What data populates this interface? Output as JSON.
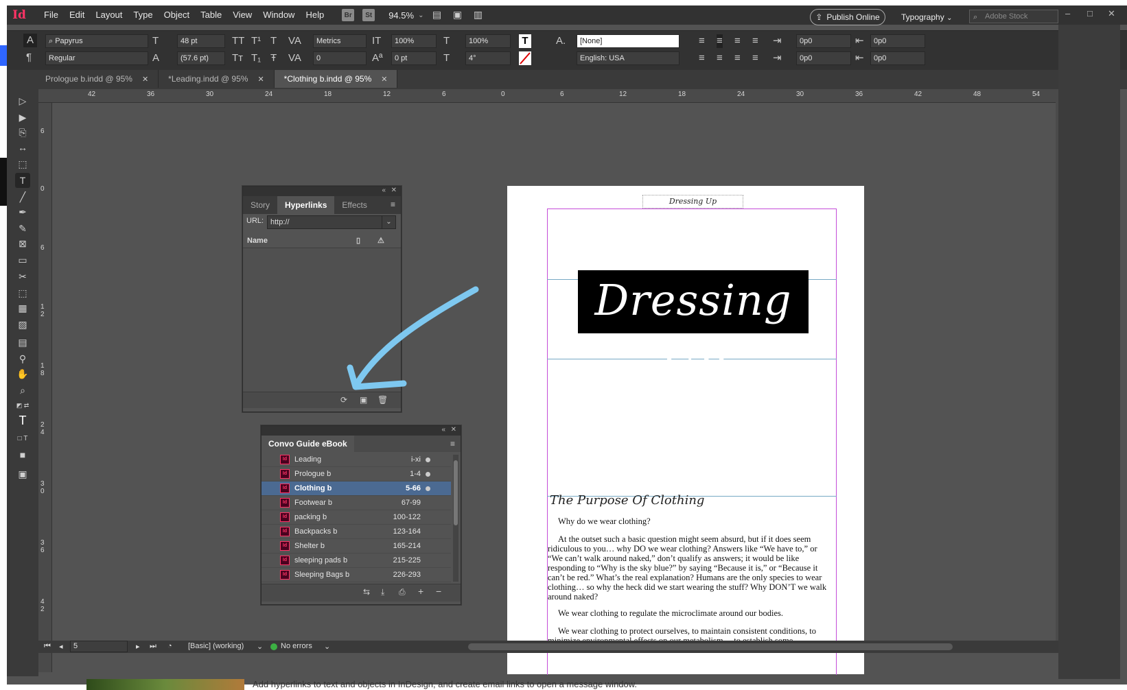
{
  "app": {
    "logo": "Id"
  },
  "menubar": {
    "items": [
      "File",
      "Edit",
      "Layout",
      "Type",
      "Object",
      "Table",
      "View",
      "Window",
      "Help"
    ],
    "bridge": "Br",
    "stock_badge": "St",
    "zoom": "94.5%",
    "publish_label": "Publish Online",
    "workspace": "Typography",
    "stock_placeholder": "Adobe Stock"
  },
  "control": {
    "font_family": "Papyrus",
    "font_style": "Regular",
    "font_size": "48 pt",
    "leading": "(57.6 pt)",
    "kerning": "Metrics",
    "tracking": "0",
    "vertical_scale": "100%",
    "horizontal_scale": "100%",
    "baseline_shift": "0 pt",
    "skew": "4°",
    "char_style": "[None]",
    "language": "English: USA",
    "left_indent": "0p0",
    "right_indent": "0p0",
    "first_indent": "0p0",
    "last_indent": "0p0"
  },
  "tabs": [
    {
      "label": "Prologue b.indd @ 95%",
      "active": false
    },
    {
      "label": "*Leading.indd @ 95%",
      "active": false
    },
    {
      "label": "*Clothing b.indd @ 95%",
      "active": true
    }
  ],
  "rulers": {
    "h": [
      "42",
      "36",
      "30",
      "24",
      "18",
      "12",
      "6",
      "0",
      "6",
      "12",
      "18",
      "24",
      "30",
      "36",
      "42",
      "48",
      "54"
    ],
    "v": [
      "6",
      "0",
      "6",
      "1\n2",
      "1\n8",
      "2\n4",
      "3\n0",
      "3\n6",
      "4\n2"
    ]
  },
  "hyperlinks_panel": {
    "tabs": [
      "Story",
      "Hyperlinks",
      "Effects"
    ],
    "url_label": "URL:",
    "url_value": "http://",
    "name_header": "Name"
  },
  "book_panel": {
    "title": "Convo Guide eBook",
    "rows": [
      {
        "name": "Leading",
        "pages": "i-xi",
        "dot": true
      },
      {
        "name": "Prologue b",
        "pages": "1-4",
        "dot": true
      },
      {
        "name": "Clothing b",
        "pages": "5-66",
        "dot": true,
        "selected": true
      },
      {
        "name": "Footwear b",
        "pages": "67-99",
        "dot": false
      },
      {
        "name": "packing b",
        "pages": "100-122",
        "dot": false
      },
      {
        "name": "Backpacks b",
        "pages": "123-164",
        "dot": false
      },
      {
        "name": "Shelter b",
        "pages": "165-214",
        "dot": false
      },
      {
        "name": "sleeping pads b",
        "pages": "215-225",
        "dot": false
      },
      {
        "name": "Sleeping Bags b",
        "pages": "226-293",
        "dot": false
      }
    ]
  },
  "document": {
    "running_header": "Dressing Up",
    "title": "Dressing Up",
    "section_heading": "The Purpose Of Clothing",
    "paragraphs": [
      "Why do we wear clothing?",
      "At the outset such a basic question might seem absurd, but if it does seem ridiculous to you… why DO we wear clothing? Answers like “We have to,” or “We can’t walk around naked,” don’t qualify as answers; it would be like responding to “Why is the sky blue?” by saying “Because it is,” or “Because it can’t be red.” What’s the real explanation? Humans are the only species to wear clothing… so why the heck did we start wearing the stuff? Why DON’T we walk around naked?",
      "We wear clothing to regulate the microclimate around our bodies.",
      "We wear clothing to protect ourselves, to maintain consistent conditions, to minimize environmental effects on our metabolism… to establish some"
    ]
  },
  "statusbar": {
    "page": "5",
    "preflight_profile": "[Basic] (working)",
    "errors": "No errors"
  },
  "caption": {
    "text": "Add hyperlinks to text and objects in InDesign, and create email links to open a message window."
  },
  "colors": {
    "accent": "#ff3366",
    "selection": "#4b6a92",
    "arrow": "#7ec8f0",
    "margin": "#c44bd8",
    "guide": "#76a8c4"
  }
}
